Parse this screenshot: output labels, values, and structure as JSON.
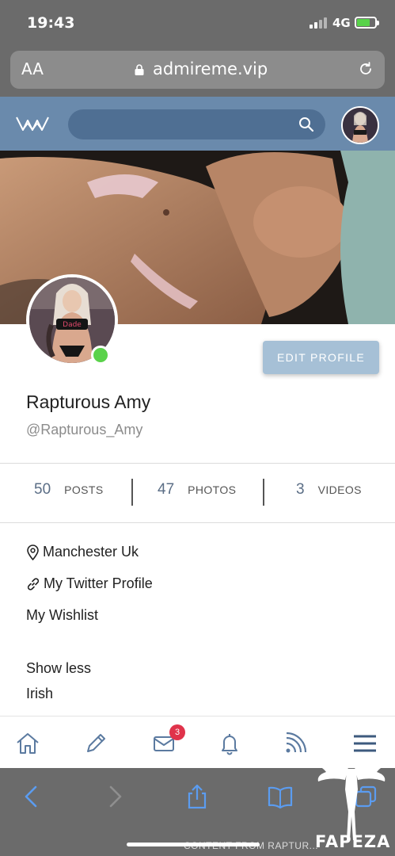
{
  "status_bar": {
    "time": "19:43",
    "network": "4G"
  },
  "browser": {
    "aa": "AA",
    "domain": "admireme.vip"
  },
  "site_header": {
    "search_placeholder": ""
  },
  "profile": {
    "display_name": "Rapturous Amy",
    "handle": "@Rapturous_Amy",
    "edit_label": "EDIT PROFILE",
    "stats": [
      {
        "count": "50",
        "label": "POSTS"
      },
      {
        "count": "47",
        "label": "PHOTOS"
      },
      {
        "count": "3",
        "label": "VIDEOS"
      }
    ],
    "location": "Manchester Uk",
    "link": "My Twitter Profile",
    "wishlist": "My Wishlist",
    "show_less": "Show less",
    "bio_line": "Irish"
  },
  "app_nav": {
    "messages_badge": "3"
  },
  "watermark": {
    "text": "CONTENT FROM RAPTUR...",
    "brand": "FAPEZA"
  },
  "colors": {
    "header": "#6a8aac",
    "edit_button": "#a6c0d6",
    "online": "#5ad24a",
    "badge": "#e0334b"
  }
}
